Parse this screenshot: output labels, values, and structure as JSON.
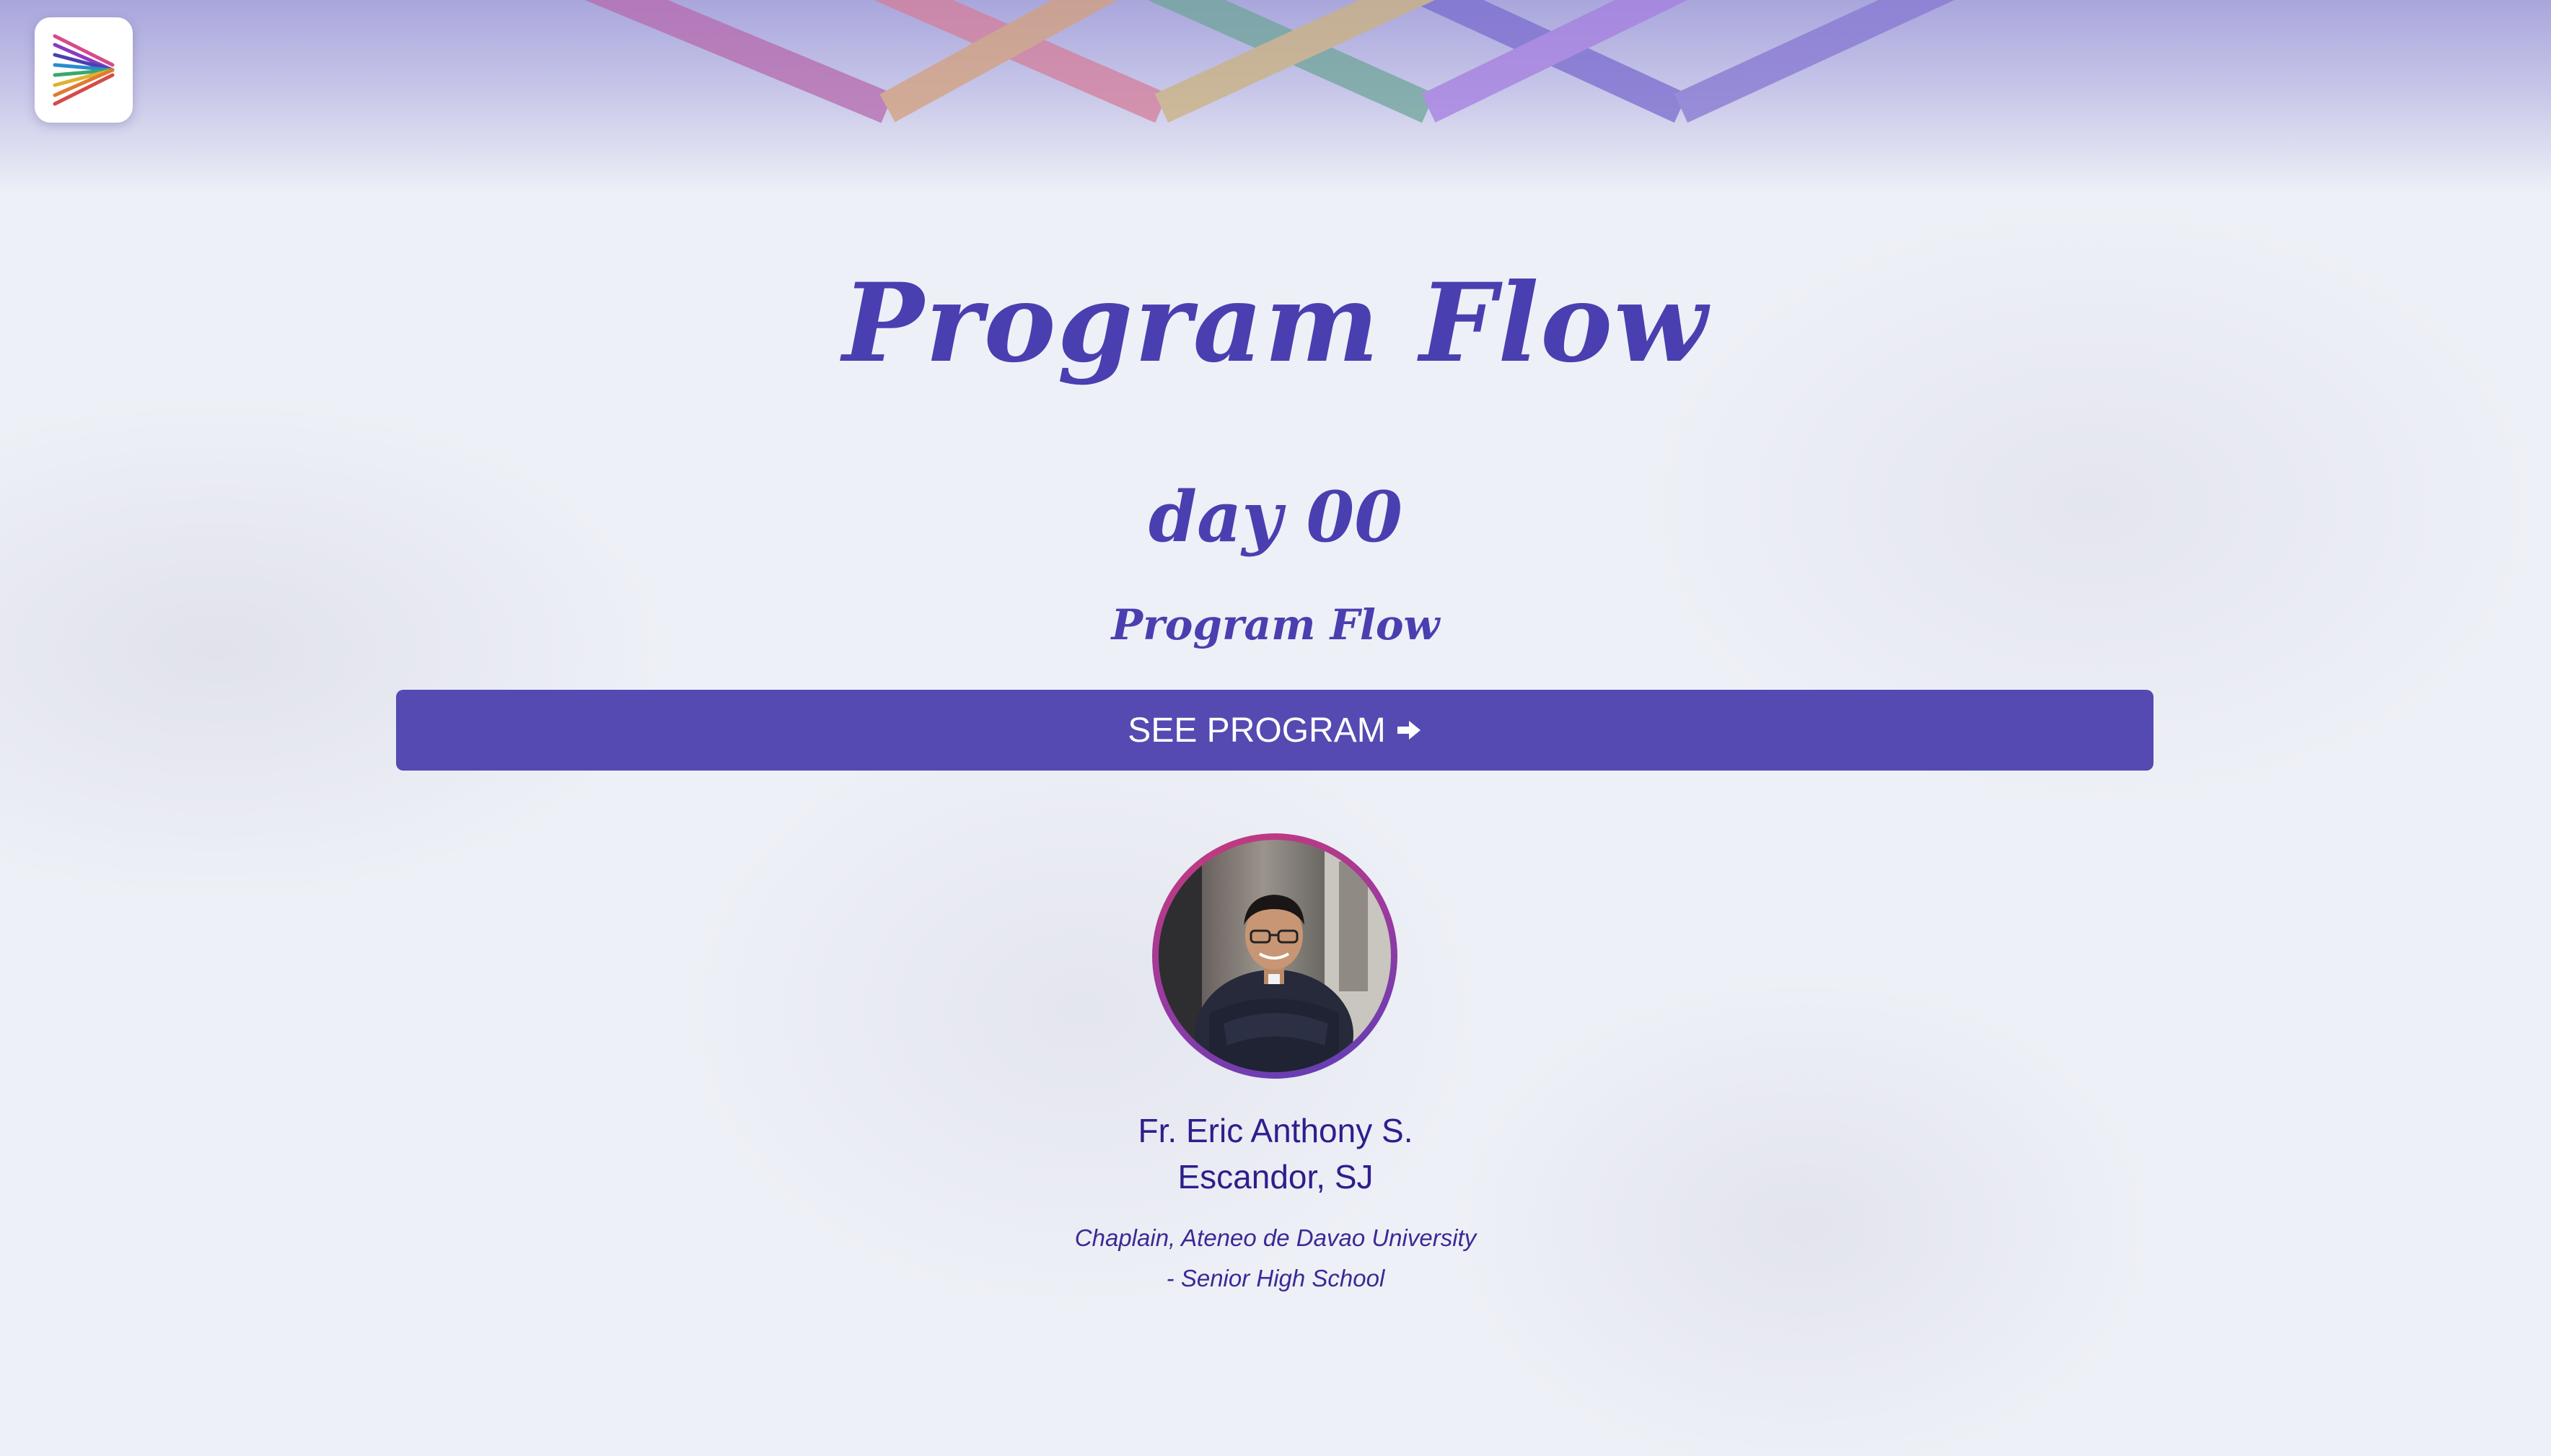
{
  "header": {
    "logo_icon": "woven-triangle-logo-icon",
    "ribbon_colors": [
      "#c46aa8",
      "#d98aa2",
      "#c9a57c",
      "#7aa89a",
      "#a07ad8",
      "#7e73cf"
    ]
  },
  "main": {
    "title": "Program Flow",
    "day": "day 00",
    "subtitle": "Program Flow",
    "button": {
      "label": "SEE PROGRAM",
      "icon": "arrow-right-icon"
    }
  },
  "speaker": {
    "name_line1": "Fr. Eric Anthony S.",
    "name_line2": "Escandor, SJ",
    "role_line1": "Chaplain, Ateneo de Davao University",
    "role_line2": "- Senior High School"
  },
  "colors": {
    "accent": "#544ab2",
    "title": "#4a3fb0",
    "name": "#2e1e8c"
  }
}
